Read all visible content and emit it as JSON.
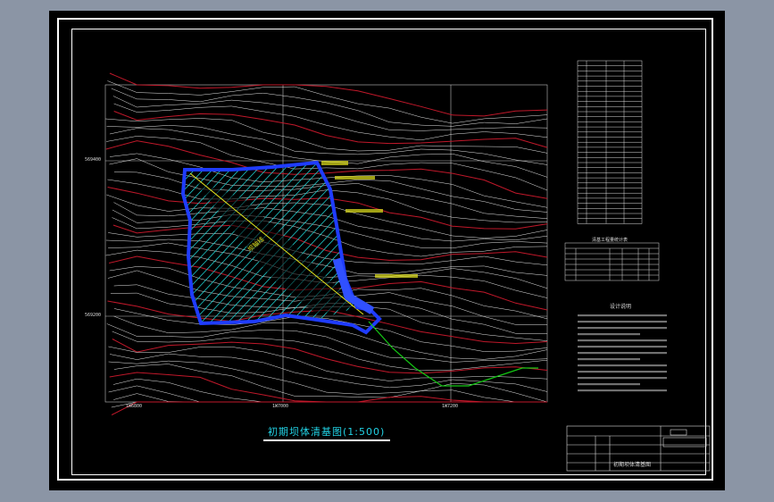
{
  "drawing": {
    "title": "初期坝体清基图(1:500)",
    "grid_labels_left": [
      "569400",
      "569200"
    ],
    "grid_labels_bottom": [
      "1W6800",
      "1W7000",
      "1W7200"
    ],
    "plan_annotations": [
      "坝轴线"
    ]
  },
  "panel": {
    "coord_table_rows": 32,
    "quantity_table_title": "清基工程量统计表",
    "notes_title": "设计说明"
  },
  "titleblock": {
    "drawing_name": "初期坝体清基图"
  },
  "colors": {
    "background": "#000000",
    "frame": "#ffffff",
    "contour_white": "#e8e8e8",
    "contour_red": "#c0182a",
    "hatch": "#1ec8c8",
    "boundary": "#1f3cff",
    "road": "#14c814",
    "axis": "#e6e61e",
    "title": "#22d3e6"
  },
  "icons": [
    "dam-plan-drawing",
    "coordinate-table",
    "title-block"
  ]
}
